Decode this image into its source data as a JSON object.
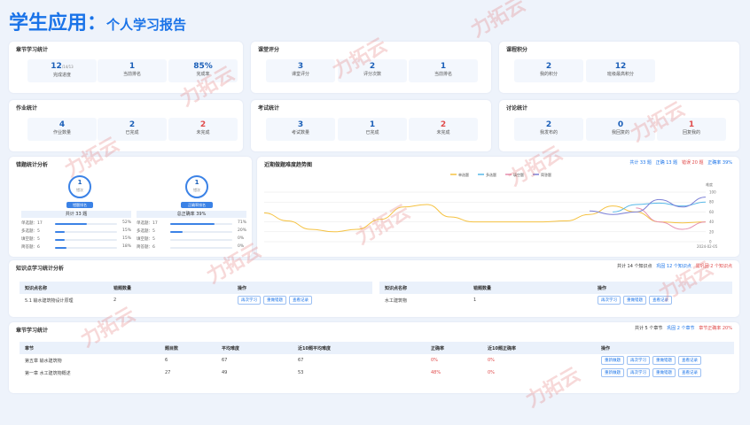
{
  "header": {
    "title_main": "学生应用：",
    "title_sub": "个人学习报告"
  },
  "chapter_stats": {
    "title": "章节学习统计",
    "items": [
      {
        "value": "12",
        "sub": "/14/13",
        "label": "完成进度"
      },
      {
        "value": "1",
        "sub": "",
        "label": "当前排名"
      },
      {
        "value": "85%",
        "sub": "",
        "label": "完成率"
      }
    ]
  },
  "class_eval": {
    "title": "课堂评分",
    "items": [
      {
        "value": "3",
        "label": "课堂评分"
      },
      {
        "value": "2",
        "label": "评分次数"
      },
      {
        "value": "1",
        "label": "当前排名"
      }
    ]
  },
  "course_points": {
    "title": "课程积分",
    "items": [
      {
        "value": "2",
        "label": "我的积分"
      },
      {
        "value": "12",
        "label": "班级最高积分"
      }
    ]
  },
  "homework": {
    "title": "作业统计",
    "items": [
      {
        "value": "4",
        "label": "作业数量"
      },
      {
        "value": "2",
        "label": "已完成"
      },
      {
        "value": "2",
        "label": "未完成"
      }
    ]
  },
  "exam": {
    "title": "考试统计",
    "items": [
      {
        "value": "3",
        "label": "考试数量"
      },
      {
        "value": "1",
        "label": "已完成"
      },
      {
        "value": "2",
        "label": "未完成"
      }
    ]
  },
  "discussion": {
    "title": "讨论统计",
    "items": [
      {
        "value": "2",
        "label": "我发布的"
      },
      {
        "value": "0",
        "label": "我回复的"
      },
      {
        "value": "1",
        "label": "回复我的"
      }
    ]
  },
  "wrong_stats": {
    "title": "错题统计分析",
    "left": {
      "circle_value": "1",
      "circle_unit": "错次",
      "badge": "错题排名",
      "total_label": "共计 33 题",
      "rows": [
        {
          "label": "单选题：17",
          "value": "52%",
          "pct": 0.52
        },
        {
          "label": "多选题：5",
          "value": "15%",
          "pct": 0.15
        },
        {
          "label": "填空题：5",
          "value": "15%",
          "pct": 0.15
        },
        {
          "label": "简答题：6",
          "value": "18%",
          "pct": 0.18
        }
      ]
    },
    "right": {
      "circle_value": "1",
      "circle_unit": "错次",
      "badge": "正确率排名",
      "total_label": "总正确率 39%",
      "rows": [
        {
          "label": "单选题：17",
          "value": "71%",
          "pct": 0.71
        },
        {
          "label": "多选题：5",
          "value": "20%",
          "pct": 0.2
        },
        {
          "label": "填空题：5",
          "value": "0%",
          "pct": 0
        },
        {
          "label": "简答题：6",
          "value": "0%",
          "pct": 0
        }
      ]
    }
  },
  "trend": {
    "title": "近期做题难度趋势图",
    "summary": {
      "total": "共计 33 题",
      "correct": "正确 13 题",
      "wrong": "错误 20 题",
      "rate": "正确率 39%"
    }
  },
  "chart_data": {
    "type": "line",
    "legend": [
      "单选题",
      "多选题",
      "填空题",
      "简答题"
    ],
    "ylabel": "难度",
    "ylim": [
      0,
      100
    ],
    "yticks": [
      0,
      20,
      40,
      60,
      80,
      100
    ],
    "x_last_label": "2024-02-05",
    "series": [
      {
        "name": "单选题",
        "values": [
          58,
          42,
          25,
          20,
          25,
          45,
          70,
          75,
          50,
          40,
          40,
          40,
          40,
          42,
          55,
          72,
          60,
          40,
          38,
          40
        ]
      },
      {
        "name": "多选题",
        "values": [
          null,
          null,
          null,
          null,
          null,
          null,
          null,
          null,
          null,
          null,
          null,
          null,
          null,
          null,
          null,
          60,
          75,
          78,
          72,
          80
        ]
      },
      {
        "name": "填空题",
        "values": [
          null,
          null,
          null,
          null,
          null,
          null,
          null,
          null,
          null,
          null,
          null,
          null,
          null,
          null,
          null,
          null,
          68,
          40,
          25,
          40
        ]
      },
      {
        "name": "简答题",
        "values": [
          null,
          null,
          null,
          null,
          null,
          null,
          null,
          null,
          null,
          null,
          null,
          null,
          null,
          null,
          62,
          55,
          60,
          85,
          70,
          90
        ]
      }
    ],
    "colors": [
      "#f5c242",
      "#57b8e8",
      "#e58fb0",
      "#7b7fd6"
    ]
  },
  "knowledge": {
    "title": "知识点学习统计分析",
    "summary": {
      "total": "共计 14 个知识点",
      "solid": "巩固 12 个知识点",
      "need": "需巩固 2 个知识点"
    },
    "headers": [
      "知识点名称",
      "错题数量",
      "操作"
    ],
    "left": [
      {
        "name": "5.1 输水建筑物设计原理",
        "count": "2",
        "actions": [
          "再次学习",
          "重做错题",
          "查看记录"
        ]
      }
    ],
    "right": [
      {
        "name": "水工建筑物",
        "count": "1",
        "actions": [
          "再次学习",
          "重做错题",
          "查看记录"
        ]
      }
    ]
  },
  "chapter_study": {
    "title": "章节学习统计",
    "summary": {
      "total": "共计 5 个章节",
      "solid": "巩固 2 个章节",
      "rate": "章节正确率 20%"
    },
    "headers": [
      "章节",
      "题目数",
      "平均难度",
      "近10题平均难度",
      "正确率",
      "近10题正确率",
      "操作"
    ],
    "rows": [
      {
        "chapter": "第五章 输水建筑物",
        "count": "6",
        "avg": "67",
        "recent_avg": "67",
        "rate": "0%",
        "recent_rate": "0%",
        "actions": [
          "重新做题",
          "再次学习",
          "重做错题",
          "查看记录"
        ]
      },
      {
        "chapter": "第一章 水工建筑物概述",
        "count": "27",
        "avg": "49",
        "recent_avg": "53",
        "rate": "48%",
        "recent_rate": "0%",
        "actions": [
          "重新做题",
          "再次学习",
          "重做错题",
          "查看记录"
        ]
      }
    ]
  },
  "watermark": "力拓云"
}
